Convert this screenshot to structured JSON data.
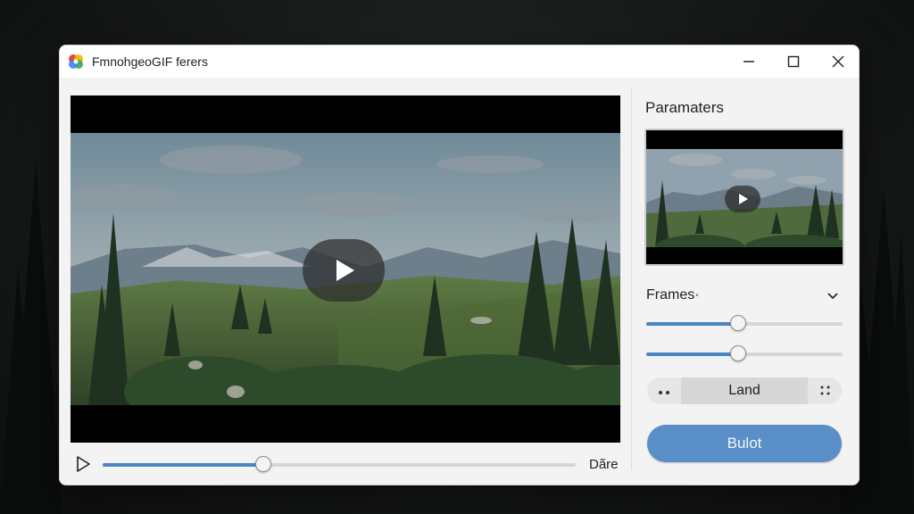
{
  "window": {
    "title": "FmnohgeoGIF ferers"
  },
  "player": {
    "time_label": "Dãre",
    "progress": 0.34
  },
  "panel": {
    "title": "Paramaters",
    "frames_label": "Frames·",
    "slider1_value": 0.47,
    "slider2_value": 0.47,
    "segment_selected": "Land",
    "primary_button": "Bulot"
  },
  "icons": {
    "app": "colorful-logo-icon",
    "minimize": "minimize-icon",
    "maximize": "maximize-icon",
    "close": "close-icon",
    "play": "play-icon",
    "chevron": "chevron-down-icon"
  },
  "colors": {
    "accent": "#4a86c4",
    "button": "#5a8ec7"
  }
}
